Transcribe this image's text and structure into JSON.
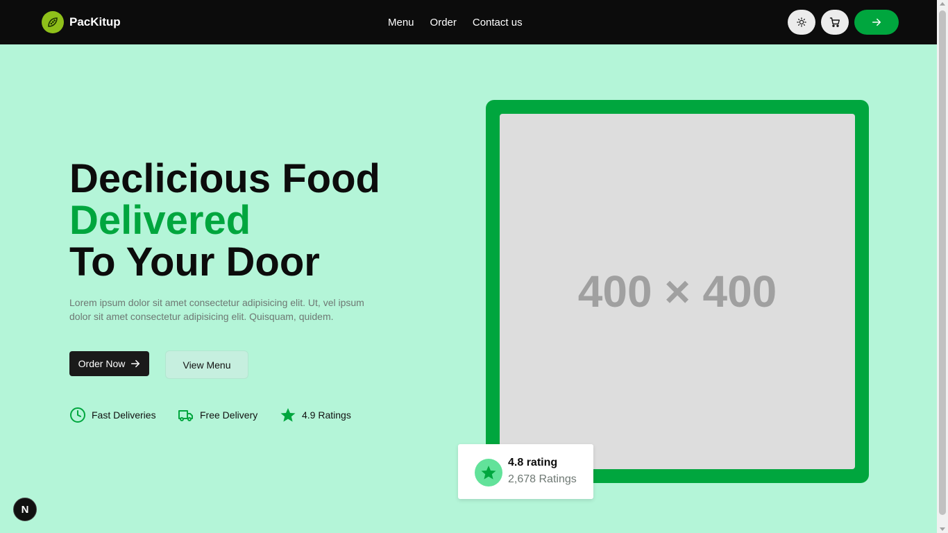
{
  "brand": {
    "name": "PacKitup",
    "logo_icon": "leaf-pod-icon"
  },
  "nav": {
    "links": [
      "Menu",
      "Order",
      "Contact us"
    ]
  },
  "header_actions": {
    "theme_icon": "sun-icon",
    "cart_icon": "cart-icon",
    "cta_icon": "arrow-right-icon"
  },
  "hero": {
    "title_line1": "Declicious Food",
    "title_line2": "Delivered",
    "title_line3": "To Your Door",
    "description": "Lorem ipsum dolor sit amet consectetur adipisicing elit. Ut, vel ipsum dolor sit amet consectetur adipisicing elit. Quisquam, quidem.",
    "order_button": "Order Now",
    "menu_button": "View Menu",
    "features": [
      {
        "icon": "clock-icon",
        "label": "Fast Deliveries"
      },
      {
        "icon": "truck-icon",
        "label": "Free Delivery"
      },
      {
        "icon": "star-icon",
        "label": "4.9 Ratings"
      }
    ]
  },
  "image_placeholder": {
    "text": "400 × 400"
  },
  "rating_card": {
    "icon": "star-icon",
    "value": "4.8 rating",
    "count": "2,678 Ratings"
  },
  "dev_badge": {
    "label": "N"
  },
  "colors": {
    "accent": "#00a63e",
    "background": "#b4f5d8",
    "navbar": "#0c0c0c",
    "brand_logo": "#8fc01a",
    "rating_badge": "#62e29a"
  }
}
